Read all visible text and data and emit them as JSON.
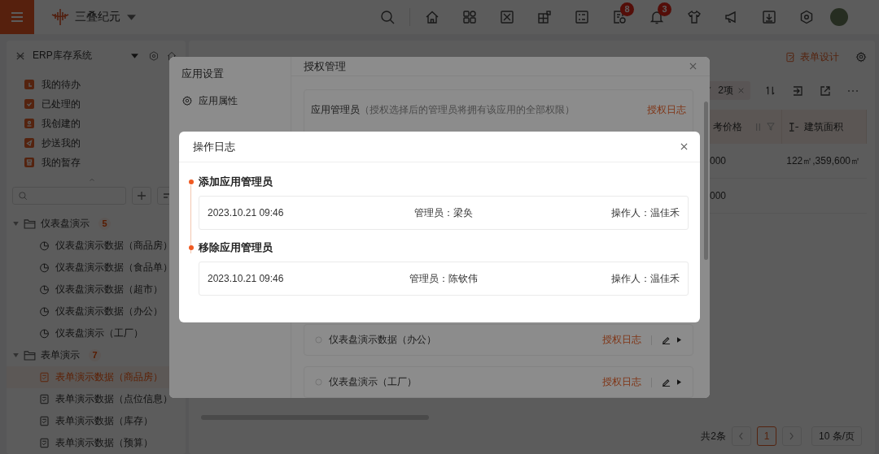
{
  "header": {
    "brand": "三叠纪元",
    "tools": [
      {
        "kind": "search"
      },
      {
        "kind": "home"
      },
      {
        "kind": "apps"
      },
      {
        "kind": "board"
      },
      {
        "kind": "widgets"
      },
      {
        "kind": "tasks"
      },
      {
        "kind": "report",
        "badge": "8"
      },
      {
        "kind": "bell",
        "badge": "3"
      },
      {
        "kind": "shirt"
      },
      {
        "kind": "megaphone"
      },
      {
        "kind": "download"
      },
      {
        "kind": "hexagon"
      }
    ]
  },
  "sidebar": {
    "title": "ERP库存系统",
    "quick_items": [
      {
        "label": "我的待办",
        "kind": "todo"
      },
      {
        "label": "已处理的",
        "kind": "done"
      },
      {
        "label": "我创建的",
        "kind": "created"
      },
      {
        "label": "抄送我的",
        "kind": "cc"
      },
      {
        "label": "我的暂存",
        "kind": "draft"
      }
    ],
    "tree": [
      {
        "label": "仪表盘演示",
        "count": "5",
        "expanded": true,
        "children": [
          {
            "label": "仪表盘演示数据（商品房）",
            "kind": "dashboard",
            "selected": false
          },
          {
            "label": "仪表盘演示数据（食品单）",
            "kind": "dashboard",
            "selected": false
          },
          {
            "label": "仪表盘演示数据（超市）",
            "kind": "dashboard",
            "selected": false
          },
          {
            "label": "仪表盘演示数据（办公）",
            "kind": "dashboard",
            "selected": false
          },
          {
            "label": "仪表盘演示（工厂）",
            "kind": "dashboard",
            "selected": false
          }
        ]
      },
      {
        "label": "表单演示",
        "count": "7",
        "expanded": true,
        "children": [
          {
            "label": "表单演示数据（商品房）",
            "kind": "form",
            "selected": true
          },
          {
            "label": "表单演示数据（点位信息）",
            "kind": "form",
            "selected": false
          },
          {
            "label": "表单演示数据（库存）",
            "kind": "form",
            "selected": false
          },
          {
            "label": "表单演示数据（预算）",
            "kind": "form",
            "selected": false
          }
        ]
      }
    ]
  },
  "main": {
    "design_button": "表单设计",
    "filter_chip": "2项",
    "table": {
      "columns": [
        {
          "label": "考价格",
          "kind": "number"
        },
        {
          "label": "建筑面积",
          "kind": "text"
        }
      ],
      "rows": [
        {
          "cells": [
            "000",
            "122㎡,359,600㎡"
          ]
        },
        {
          "cells": [
            "000"
          ]
        }
      ]
    },
    "pagination": {
      "total": "共2条",
      "pages": [
        {
          "label": "1",
          "selected": true
        }
      ],
      "page_size": "10 条/页"
    }
  },
  "settings_dialog": {
    "title": "应用设置",
    "nav": [
      {
        "label": "应用属性",
        "kind": "gear"
      }
    ],
    "panel_title": "授权管理",
    "admin_card": {
      "label": "应用管理员",
      "hint": "（授权选择后的管理员将拥有该应用的全部权限）",
      "link": "授权日志"
    },
    "apps": [
      {
        "label": "仪表盘演示数据（办公）",
        "link": "授权日志"
      },
      {
        "label": "仪表盘演示（工厂）",
        "link": "授权日志"
      }
    ]
  },
  "log_dialog": {
    "title": "操作日志",
    "entries": [
      {
        "action": "添加应用管理员",
        "time": "2023.10.21 09:46",
        "admin": "管理员：梁奂",
        "operator": "操作人：温佳禾"
      },
      {
        "action": "移除应用管理员",
        "time": "2023.10.21 09:46",
        "admin": "管理员：陈钦伟",
        "operator": "操作人：温佳禾"
      }
    ]
  }
}
